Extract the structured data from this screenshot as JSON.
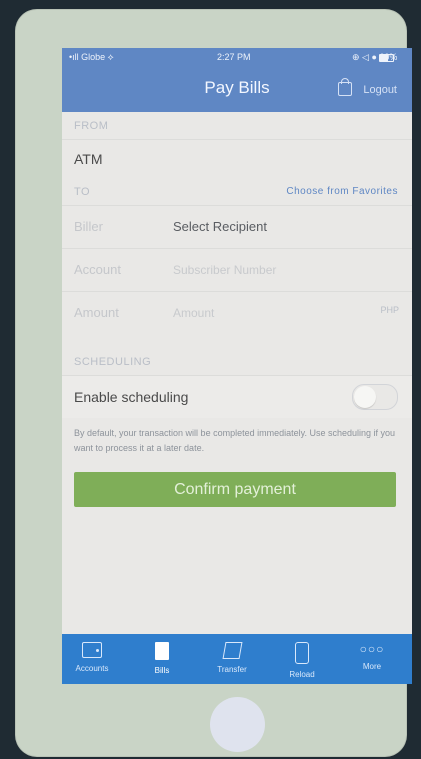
{
  "status_bar": {
    "carrier": "•ıll Globe ⟡",
    "time": "2:27 PM",
    "battery": "⊕ ◁ ● 60%"
  },
  "nav": {
    "title": "Pay Bills",
    "logout_label": "Logout"
  },
  "sections": {
    "from_header": "FROM",
    "to_header": "TO",
    "scheduling_header": "SCHEDULING"
  },
  "from": {
    "value": "ATM"
  },
  "to": {
    "favorites_label": "Choose from Favorites",
    "biller_label": "Biller",
    "biller_value": "Select Recipient",
    "account_label": "Account",
    "account_placeholder": "Subscriber Number",
    "amount_label": "Amount",
    "amount_placeholder": "Amount",
    "currency": "PHP"
  },
  "scheduling": {
    "enable_label": "Enable scheduling",
    "enabled": false,
    "note": "By default, your transaction will be completed immediately. Use scheduling if you want to process it at a later date."
  },
  "actions": {
    "confirm_label": "Confirm payment"
  },
  "tabs": [
    {
      "label": "Accounts",
      "icon": "wallet-icon"
    },
    {
      "label": "Bills",
      "icon": "bill-icon"
    },
    {
      "label": "Transfer",
      "icon": "transfer-icon"
    },
    {
      "label": "Reload",
      "icon": "phone-icon"
    },
    {
      "label": "More",
      "icon": "more-icon"
    }
  ],
  "colors": {
    "nav_blue": "#5f87c4",
    "tab_blue": "#2f7ecd",
    "confirm_green": "#7fae58"
  }
}
